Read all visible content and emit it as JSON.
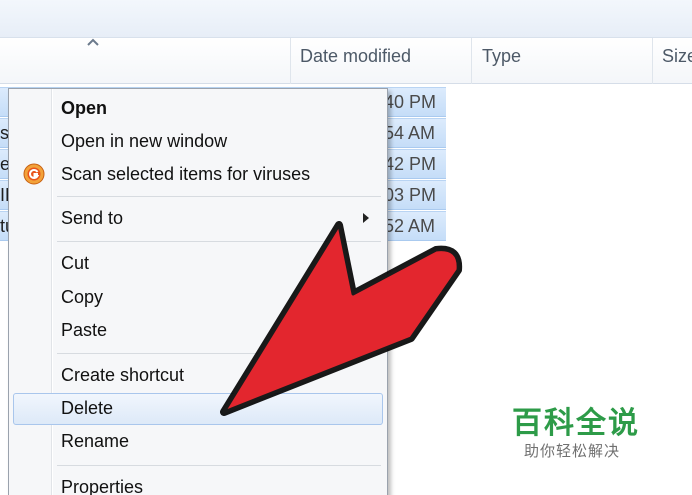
{
  "columns": {
    "date_modified": "Date modified",
    "type": "Type",
    "size": "Size"
  },
  "rows": [
    {
      "stub": "",
      "time": "40 PM"
    },
    {
      "stub": "sh",
      "time": "54 AM"
    },
    {
      "stub": "ei",
      "time": "42 PM"
    },
    {
      "stub": "IP",
      "time": "03 PM"
    },
    {
      "stub": "tu",
      "time": "52 AM"
    }
  ],
  "context_menu": {
    "open": "Open",
    "open_new_window": "Open in new window",
    "scan": "Scan selected items for viruses",
    "send_to": "Send to",
    "cut": "Cut",
    "copy": "Copy",
    "paste": "Paste",
    "create_shortcut": "Create shortcut",
    "delete": "Delete",
    "rename": "Rename",
    "properties": "Properties"
  },
  "watermark": {
    "title": "百科全说",
    "subtitle": "助你轻松解决"
  },
  "colors": {
    "arrow": "#e3262e",
    "selection": "#cfe3fa",
    "watermark_green": "#2d9b48"
  }
}
